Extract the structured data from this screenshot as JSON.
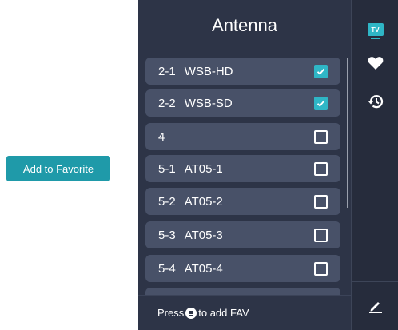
{
  "favorite_button": {
    "label": "Add to Favorite"
  },
  "panel": {
    "title": "Antenna",
    "channels": [
      {
        "number": "2-1",
        "name": "WSB-HD",
        "checked": true
      },
      {
        "number": "2-2",
        "name": "WSB-SD",
        "checked": true
      },
      {
        "number": "4",
        "name": "",
        "checked": false
      },
      {
        "number": "5-1",
        "name": "AT05-1",
        "checked": false
      },
      {
        "number": "5-2",
        "name": "AT05-2",
        "checked": false
      },
      {
        "number": "5-3",
        "name": "AT05-3",
        "checked": false
      },
      {
        "number": "5-4",
        "name": "AT05-4",
        "checked": false
      }
    ],
    "footer": {
      "prefix": "Press",
      "suffix": "to add FAV"
    }
  },
  "sidebar": {
    "tv_label": "TV",
    "icons": [
      "tv-icon",
      "heart-icon",
      "history-icon",
      "edit-icon"
    ]
  },
  "colors": {
    "accent": "#2fb6c6",
    "button": "#1f9aa9",
    "panel_bg": "#2d3447",
    "row_bg": "#485168",
    "sidebar_bg": "#262c3c"
  }
}
